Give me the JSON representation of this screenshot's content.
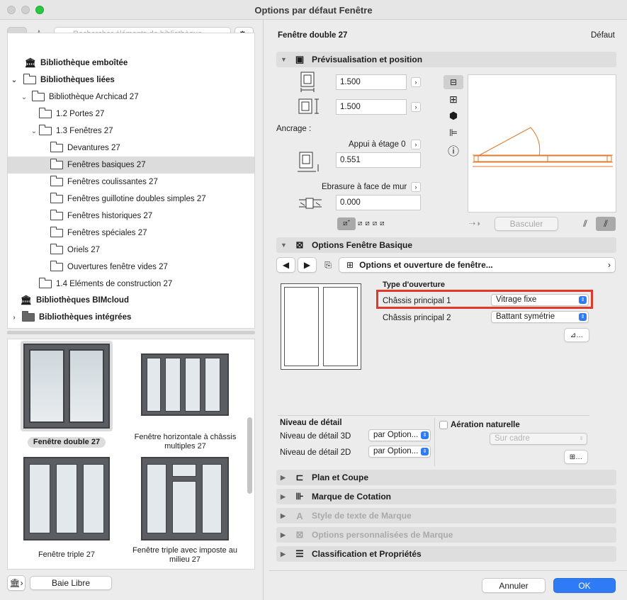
{
  "window": {
    "title": "Options par défaut Fenêtre"
  },
  "left": {
    "search_placeholder": "Rechercher éléments de bibliothèque",
    "tree": [
      {
        "label": "Bibliothèque emboîtée"
      },
      {
        "label": "Bibliothèques liées"
      },
      {
        "label": "Bibliothèque Archicad 27"
      },
      {
        "label": "1.2 Portes 27"
      },
      {
        "label": "1.3 Fenêtres 27"
      },
      {
        "label": "Devantures 27"
      },
      {
        "label": "Fenêtres basiques 27"
      },
      {
        "label": "Fenêtres coulissantes 27"
      },
      {
        "label": "Fenêtres guillotine doubles simples 27"
      },
      {
        "label": "Fenêtres historiques 27"
      },
      {
        "label": "Fenêtres spéciales 27"
      },
      {
        "label": "Oriels 27"
      },
      {
        "label": "Ouvertures fenêtre vides 27"
      },
      {
        "label": "1.4 Eléments de construction 27"
      },
      {
        "label": "Bibliothèques BIMcloud"
      },
      {
        "label": "Bibliothèques intégrées"
      }
    ],
    "thumbs": [
      {
        "label": "Fenêtre double 27"
      },
      {
        "label": "Fenêtre horizontale à châssis multiples 27"
      },
      {
        "label": "Fenêtre triple 27"
      },
      {
        "label": "Fenêtre triple avec imposte au milieu 27"
      }
    ],
    "baie_libre": "Baie Libre"
  },
  "right": {
    "element_name": "Fenêtre double 27",
    "default_label": "Défaut",
    "sections": {
      "preview": "Prévisualisation et position",
      "options": "Options Fenêtre Basique",
      "plan": "Plan et Coupe",
      "dim": "Marque de Cotation",
      "textstyle": "Style de texte de Marque",
      "custom": "Options personnalisées de Marque",
      "classif": "Classification et Propriétés"
    },
    "width": "1.500",
    "height": "1.500",
    "anchor_label": "Ancrage :",
    "sill_label": "Appui à étage 0",
    "sill_value": "0.551",
    "reveal_label": "Ebrasure à face de mur",
    "reveal_value": "0.000",
    "flip_label": "Basculer",
    "page_selector": "Options et ouverture de fenêtre...",
    "opening_type_label": "Type d'ouverture",
    "sash1_label": "Châssis principal 1",
    "sash1_value": "Vitrage fixe",
    "sash2_label": "Châssis principal 2",
    "sash2_value": "Battant symétrie",
    "detail_label": "Niveau de détail",
    "detail3d_label": "Niveau de détail 3D",
    "detail3d_value": "par Option...",
    "detail2d_label": "Niveau de détail 2D",
    "detail2d_value": "par Option...",
    "ventilation_label": "Aération naturelle",
    "ventilation_value": "Sur cadre",
    "cancel": "Annuler",
    "ok": "OK"
  },
  "colors": {
    "accent": "#2f7bf5",
    "highlight": "#e0392b",
    "plan_line": "#e07a2e"
  }
}
